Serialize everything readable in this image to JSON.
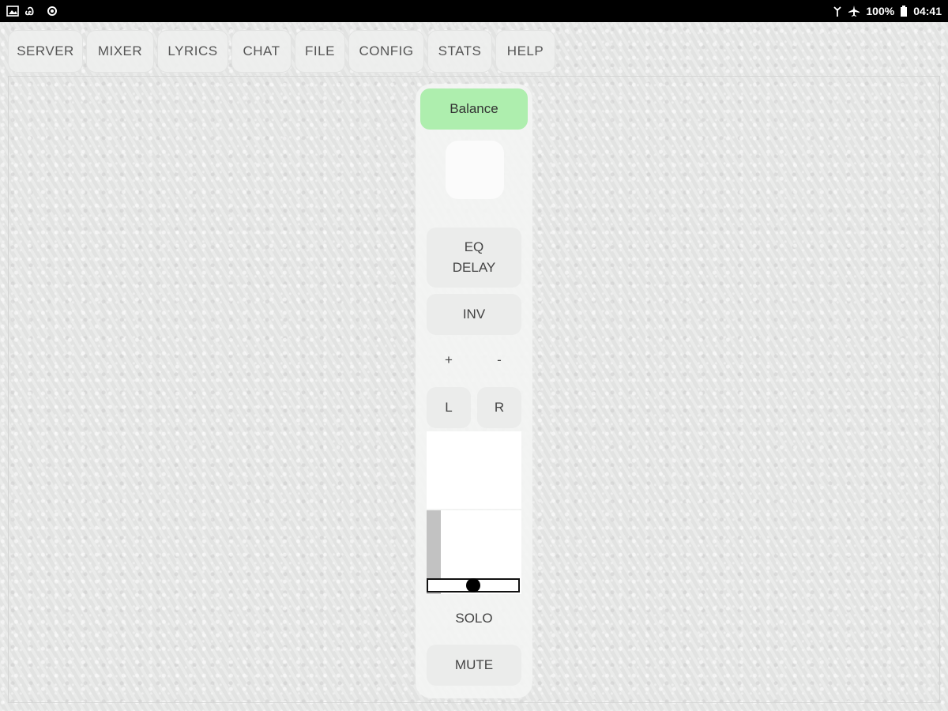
{
  "status_bar": {
    "left_icons": [
      "image-icon",
      "link-icon",
      "settings-icon"
    ],
    "right_icons": [
      "signal-icon",
      "airplane-icon"
    ],
    "battery_text": "100%",
    "battery_icon": "battery-icon",
    "time": "04:41"
  },
  "tabs": [
    {
      "label": "SERVER",
      "id": "server"
    },
    {
      "label": "MIXER",
      "id": "mixer"
    },
    {
      "label": "LYRICS",
      "id": "lyrics"
    },
    {
      "label": "CHAT",
      "id": "chat"
    },
    {
      "label": "FILE",
      "id": "file"
    },
    {
      "label": "CONFIG",
      "id": "config"
    },
    {
      "label": "STATS",
      "id": "stats"
    },
    {
      "label": "HELP",
      "id": "help"
    }
  ],
  "channel": {
    "name_label": "Balance",
    "eq_line1": "EQ",
    "eq_line2": "DELAY",
    "inv_label": "INV",
    "plus_label": "+",
    "minus_label": "-",
    "left_label": "L",
    "right_label": "R",
    "solo_label": "SOLO",
    "mute_label": "MUTE",
    "level_fraction": 1.0,
    "pan_fraction": 0.5
  },
  "colors": {
    "balance_active": "#aeeeae",
    "knob": "#000000",
    "meter_fill": "#c2c2c2"
  }
}
